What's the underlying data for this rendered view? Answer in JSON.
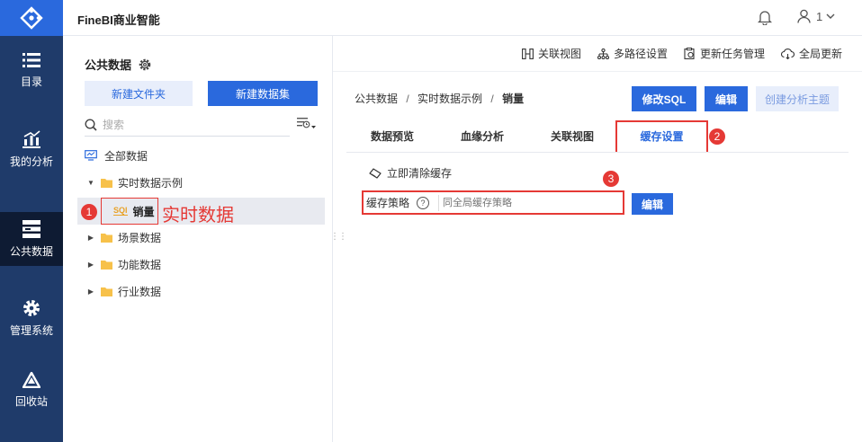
{
  "app": {
    "title": "FineBI商业智能"
  },
  "user": {
    "name": "1"
  },
  "leftnav": {
    "items": [
      {
        "label": "目录",
        "icon": "catalog-icon"
      },
      {
        "label": "我的分析",
        "icon": "analysis-icon"
      },
      {
        "label": "公共数据",
        "icon": "public-data-icon",
        "active": true
      },
      {
        "label": "管理系统",
        "icon": "gear-icon"
      },
      {
        "label": "回收站",
        "icon": "recycle-icon"
      }
    ]
  },
  "leftpanel": {
    "title": "公共数据",
    "new_folder": "新建文件夹",
    "new_dataset": "新建数据集",
    "search_placeholder": "搜索",
    "tree": {
      "all": "全部数据",
      "realtime_folder": "实时数据示例",
      "sql_label": "SQl",
      "selected_item": "销量",
      "scene": "场景数据",
      "function": "功能数据",
      "industry": "行业数据"
    },
    "annotation_text": "实时数据"
  },
  "toolbar": {
    "relation_view": "关联视图",
    "multipath": "多路径设置",
    "update_task": "更新任务管理",
    "global_update": "全局更新"
  },
  "breadcrumb": {
    "root": "公共数据",
    "folder": "实时数据示例",
    "current": "销量",
    "sep": "/"
  },
  "actions": {
    "edit_sql": "修改SQL",
    "edit": "编辑",
    "create_topic": "创建分析主题"
  },
  "tabs": [
    {
      "label": "数据预览"
    },
    {
      "label": "血缘分析"
    },
    {
      "label": "关联视图"
    },
    {
      "label": "缓存设置",
      "active": true
    }
  ],
  "cache": {
    "clear": "立即清除缓存",
    "strategy_label": "缓存策略",
    "strategy_placeholder": "同全局缓存策略",
    "edit": "编辑"
  },
  "markers": {
    "one": "1",
    "two": "2",
    "three": "3"
  },
  "colors": {
    "nav_bg": "#1f3b6a",
    "nav_active": "#0e1b33",
    "primary": "#2a69dd",
    "annotation_red": "#e53935"
  }
}
